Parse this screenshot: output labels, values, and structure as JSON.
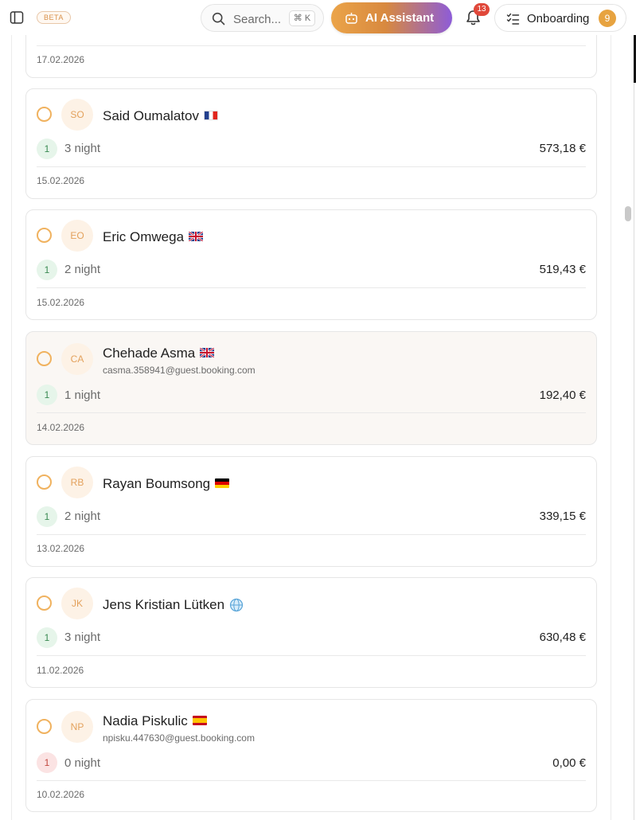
{
  "header": {
    "beta_label": "BETA",
    "search_placeholder": "Search...",
    "search_shortcut": "⌘ K",
    "ai_label": "AI Assistant",
    "notifications_count": "13",
    "onboarding_label": "Onboarding",
    "onboarding_count": "9"
  },
  "colors": {
    "accent": "#e7a340",
    "ai_gradient_start": "#eba449",
    "ai_gradient_end": "#8d5cd8",
    "badge_red": "#e0483a"
  },
  "previous_card": {
    "date": "17.02.2026"
  },
  "bookings": [
    {
      "initials": "SO",
      "name": "Said Oumalatov",
      "flag": "flag-fr",
      "email": "",
      "guests": "1",
      "nights": "3 night",
      "price": "573,18 €",
      "date": "15.02.2026",
      "guest_status": "green"
    },
    {
      "initials": "EO",
      "name": "Eric Omwega",
      "flag": "flag-gb",
      "email": "",
      "guests": "1",
      "nights": "2 night",
      "price": "519,43 €",
      "date": "15.02.2026",
      "guest_status": "green"
    },
    {
      "initials": "CA",
      "name": "Chehade Asma",
      "flag": "flag-gb",
      "email": "casma.358941@guest.booking.com",
      "guests": "1",
      "nights": "1 night",
      "price": "192,40 €",
      "date": "14.02.2026",
      "guest_status": "green",
      "highlighted": true
    },
    {
      "initials": "RB",
      "name": "Rayan Boumsong",
      "flag": "flag-de",
      "email": "",
      "guests": "1",
      "nights": "2 night",
      "price": "339,15 €",
      "date": "13.02.2026",
      "guest_status": "green"
    },
    {
      "initials": "JK",
      "name": "Jens Kristian Lütken",
      "flag": "globe",
      "email": "",
      "guests": "1",
      "nights": "3 night",
      "price": "630,48 €",
      "date": "11.02.2026",
      "guest_status": "green"
    },
    {
      "initials": "NP",
      "name": "Nadia Piskulic",
      "flag": "flag-es",
      "email": "npisku.447630@guest.booking.com",
      "guests": "1",
      "nights": "0 night",
      "price": "0,00 €",
      "date": "10.02.2026",
      "guest_status": "red"
    }
  ]
}
